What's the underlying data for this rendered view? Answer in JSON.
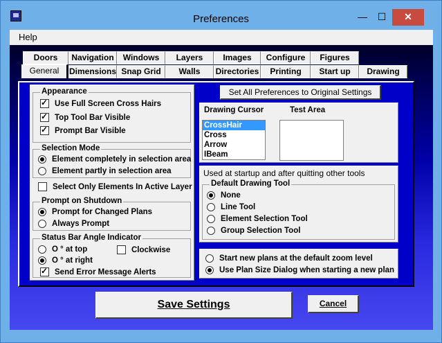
{
  "window": {
    "title": "Preferences",
    "min": "—",
    "max": "☐",
    "close": "✕"
  },
  "menu": {
    "help": "Help"
  },
  "tabs": {
    "row1": [
      "Doors",
      "Navigation",
      "Windows",
      "Layers",
      "Images",
      "Configure",
      "Figures"
    ],
    "row2": [
      "General",
      "Dimensions",
      "Snap Grid",
      "Walls",
      "Directories",
      "Printing",
      "Start up",
      "Drawing"
    ]
  },
  "appearance": {
    "title": "Appearance",
    "items": [
      {
        "label": "Use Full Screen Cross Hairs",
        "checked": true
      },
      {
        "label": "Top Tool Bar Visible",
        "checked": true
      },
      {
        "label": "Prompt Bar Visible",
        "checked": true
      }
    ]
  },
  "selection_mode": {
    "title": "Selection Mode",
    "opt1": "Element completely in selection area",
    "opt2": "Element partly in selection area"
  },
  "active_layer": {
    "label": "Select Only Elements In Active Layer",
    "checked": false
  },
  "prompt_shutdown": {
    "title": "Prompt on Shutdown",
    "opt1": "Prompt for Changed Plans",
    "opt2": "Always Prompt"
  },
  "status_bar": {
    "title": "Status Bar Angle Indicator",
    "opt1": "O ° at top",
    "opt2": "O ° at right",
    "clockwise": "Clockwise"
  },
  "error_alerts": {
    "label": "Send Error Message Alerts",
    "checked": true
  },
  "reset_button": "Set All Preferences to Original Settings",
  "cursor": {
    "label": "Drawing Cursor",
    "items": [
      "CrossHair",
      "Cross",
      "Arrow",
      "IBeam"
    ],
    "selected": "CrossHair"
  },
  "test_area": {
    "label": "Test Area"
  },
  "startup_tool": {
    "caption": "Used at startup and after quitting other tools",
    "title": "Default Drawing Tool",
    "options": [
      "None",
      "Line Tool",
      "Element Selection Tool",
      "Group Selection Tool"
    ]
  },
  "zoom": {
    "opt1": "Start new plans at the default zoom level",
    "opt2": "Use Plan Size Dialog when starting a new plan"
  },
  "footer": {
    "save": "Save Settings",
    "cancel": "Cancel"
  }
}
